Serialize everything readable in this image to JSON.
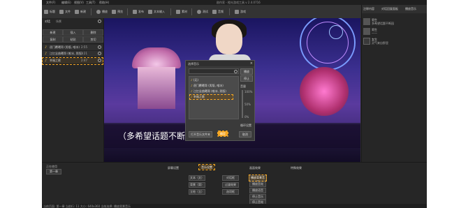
{
  "menubar": {
    "items": [
      "文件(F)",
      "编辑(E)",
      "视图(V)",
      "工具(T)",
      "帮助(H)"
    ],
    "window_title": "剧作家 - 橙光游戏工具 v 2.4.0716"
  },
  "toolbar": {
    "items": [
      "标题",
      "文件",
      "新建",
      "播放",
      "预览",
      "发布",
      "文本输入",
      "素材",
      "测试",
      "音频",
      "游戏"
    ]
  },
  "left_panel": {
    "tabs": [
      "对话",
      "场景"
    ],
    "buttons": [
      "新建",
      "插入",
      "删除",
      "复制",
      "粘贴",
      "剪切"
    ],
    "items": [
      {
        "name": "逐门覆曦哥 (男版, 唯冰)",
        "duration": "2:55"
      },
      {
        "name": "江忆念曲曦哥 (唯冰, 男版)",
        "duration": "3:21"
      },
      {
        "name": "幸福之歌",
        "duration": "2:47"
      }
    ],
    "footer_label": "正在使用",
    "footer_button": "第一章"
  },
  "preview": {
    "subtitle": "（多希望话题不断园"
  },
  "dialog": {
    "title": "选择音乐",
    "list": [
      "(无)",
      "逐门覆曦哥 (男版, 唯冰)",
      "江忆念曲曦哥 (唯冰, 男版)",
      "幸福之歌"
    ],
    "side_buttons": [
      "播放",
      "停止"
    ],
    "side_labels": [
      "音量",
      "100%",
      "50%",
      "0%"
    ],
    "bottom_left_button": "打开音乐文件夹",
    "ok": "确定",
    "cancel": "取消",
    "loop": "循环设置"
  },
  "right_panel": {
    "top_tabs": [
      "注释内容",
      "对话回复面板",
      "播放音乐"
    ],
    "items": [
      {
        "name": "男生",
        "text": "多希望话题不断园"
      },
      {
        "name": "男生",
        "text": "一一"
      },
      {
        "name": "女生",
        "text": "灵气来自那里"
      }
    ]
  },
  "bottom": {
    "tabs": [
      "屏幕设置",
      "音乐设置",
      "画面效果",
      "特殊效果"
    ],
    "buttons_col1": [
      "文本（文）",
      "背景（背）",
      "立绘（立）"
    ],
    "buttons_col2": [
      "对话框",
      "过渡效果",
      "选项框"
    ],
    "buttons_col3": [
      "播放背景音乐",
      "播放音效",
      "播放语音",
      "停止音乐",
      "停止音效"
    ]
  },
  "statusbar": {
    "text": "当前页面: 第一章 当前行: 11  大小: 640x360  当前选择: 播放背景音乐"
  },
  "accent_color": "#f5a623"
}
